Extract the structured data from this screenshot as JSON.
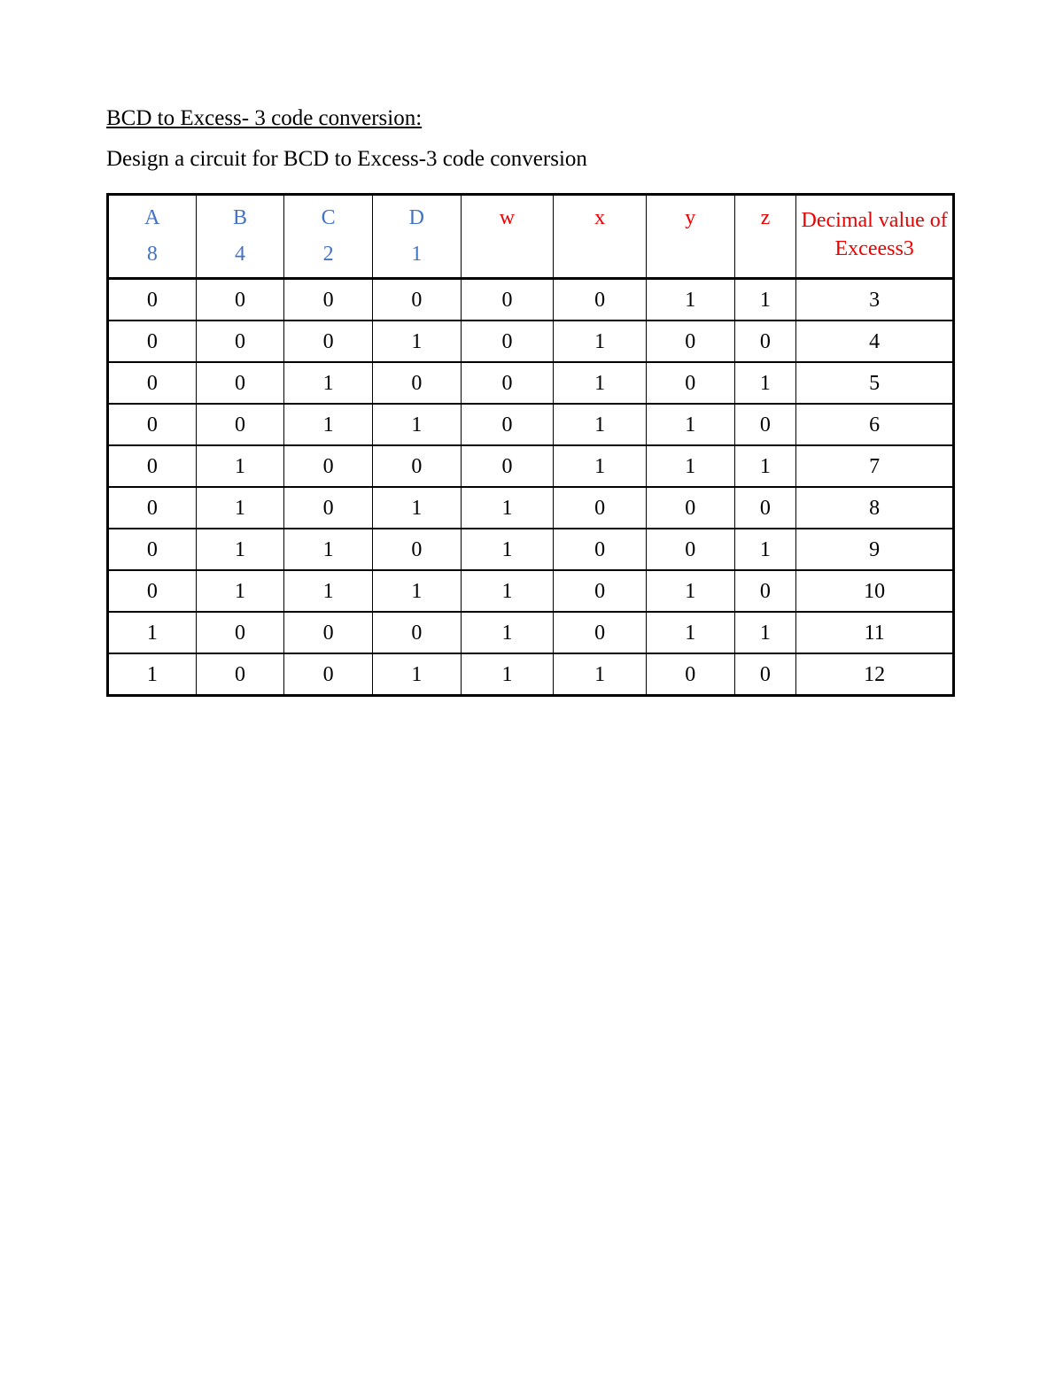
{
  "title": "BCD to Excess- 3 code conversion:",
  "subtitle": "Design a circuit for BCD to Excess-3 code conversion",
  "table": {
    "headers": {
      "a": {
        "line1": "A",
        "line2": "8"
      },
      "b": {
        "line1": "B",
        "line2": "4"
      },
      "c": {
        "line1": "C",
        "line2": "2"
      },
      "d": {
        "line1": "D",
        "line2": "1"
      },
      "w": "w",
      "x": "x",
      "y": "y",
      "z": "z",
      "decimal": "Decimal value of Exceess3"
    },
    "rows": [
      {
        "a": "0",
        "b": "0",
        "c": "0",
        "d": "0",
        "w": "0",
        "x": "0",
        "y": "1",
        "z": "1",
        "dec": "3"
      },
      {
        "a": "0",
        "b": "0",
        "c": "0",
        "d": "1",
        "w": "0",
        "x": "1",
        "y": "0",
        "z": "0",
        "dec": "4"
      },
      {
        "a": "0",
        "b": "0",
        "c": "1",
        "d": "0",
        "w": "0",
        "x": "1",
        "y": "0",
        "z": "1",
        "dec": "5"
      },
      {
        "a": "0",
        "b": "0",
        "c": "1",
        "d": "1",
        "w": "0",
        "x": "1",
        "y": "1",
        "z": "0",
        "dec": "6"
      },
      {
        "a": "0",
        "b": "1",
        "c": "0",
        "d": "0",
        "w": "0",
        "x": "1",
        "y": "1",
        "z": "1",
        "dec": "7"
      },
      {
        "a": "0",
        "b": "1",
        "c": "0",
        "d": "1",
        "w": "1",
        "x": "0",
        "y": "0",
        "z": "0",
        "dec": "8"
      },
      {
        "a": "0",
        "b": "1",
        "c": "1",
        "d": "0",
        "w": "1",
        "x": "0",
        "y": "0",
        "z": "1",
        "dec": "9"
      },
      {
        "a": "0",
        "b": "1",
        "c": "1",
        "d": "1",
        "w": "1",
        "x": "0",
        "y": "1",
        "z": "0",
        "dec": "10"
      },
      {
        "a": "1",
        "b": "0",
        "c": "0",
        "d": "0",
        "w": "1",
        "x": "0",
        "y": "1",
        "z": "1",
        "dec": "11"
      },
      {
        "a": "1",
        "b": "0",
        "c": "0",
        "d": "1",
        "w": "1",
        "x": "1",
        "y": "0",
        "z": "0",
        "dec": "12"
      }
    ]
  }
}
